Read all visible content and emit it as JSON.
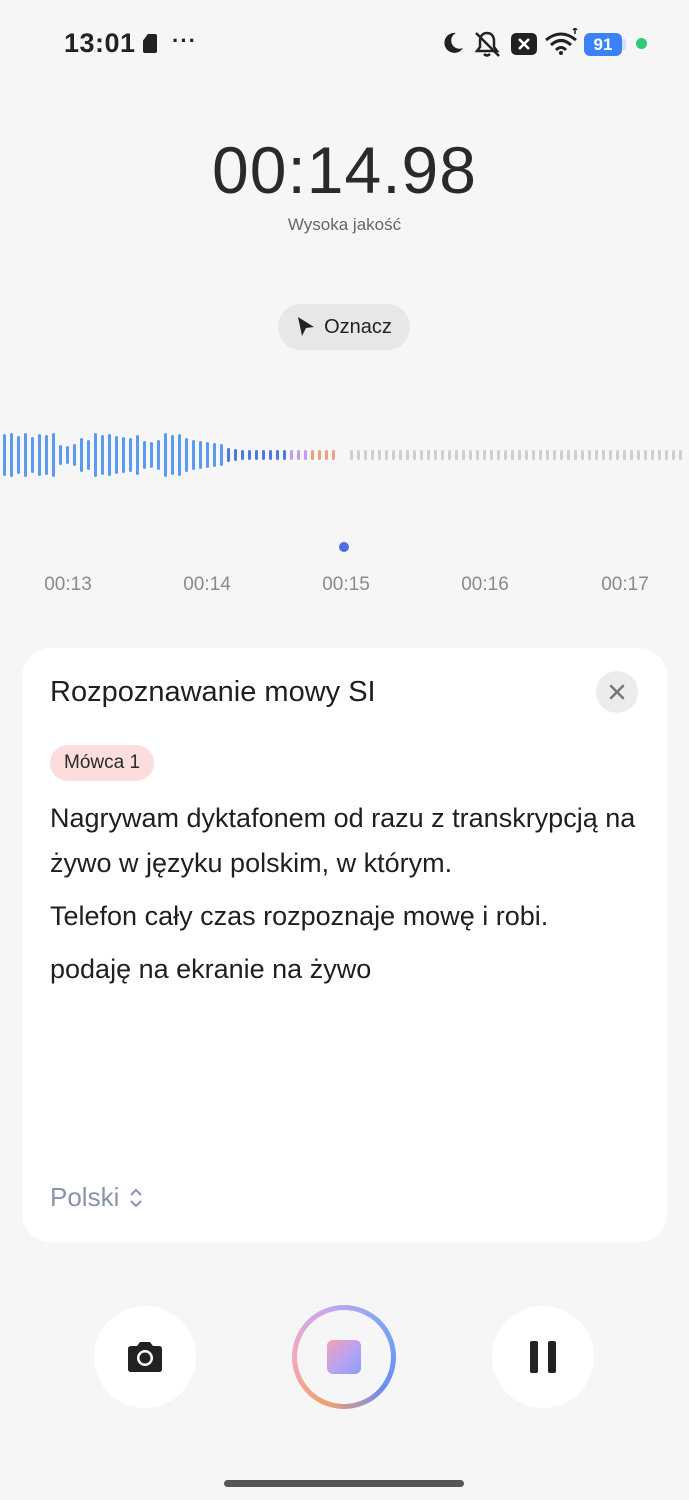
{
  "status_bar": {
    "time": "13:01",
    "more": "···",
    "icons": [
      "sim-card-icon",
      "moon-icon",
      "bell-off-icon",
      "close-box-icon",
      "wifi-icon"
    ],
    "battery": "91",
    "colors": {
      "battery": "#3b82f6",
      "dot": "#2ecc71"
    }
  },
  "recorder": {
    "timer": "00:14.98",
    "quality": "Wysoka jakość",
    "mark_label": "Oznacz",
    "timeline": [
      "00:13",
      "00:14",
      "00:15",
      "00:16",
      "00:17"
    ]
  },
  "transcription": {
    "title": "Rozpoznawanie mowy SI",
    "speaker": "Mówca 1",
    "paragraphs": [
      "Nagrywam dyktafonem od razu z transkrypcją na żywo w języku polskim, w którym.",
      "Telefon cały czas rozpoznaje mowę i robi.",
      "podaję na ekranie na żywo"
    ],
    "language": "Polski"
  },
  "controls": {
    "icons": [
      "camera-icon",
      "stop-icon",
      "pause-icon"
    ]
  },
  "colors": {
    "wave_recorded": "#5a9bf0",
    "wave_pending": "#cfcfcf",
    "playhead_top": "#f0a070",
    "playhead_bottom": "#4f6fe0",
    "speaker_chip": "#fbdddd"
  }
}
